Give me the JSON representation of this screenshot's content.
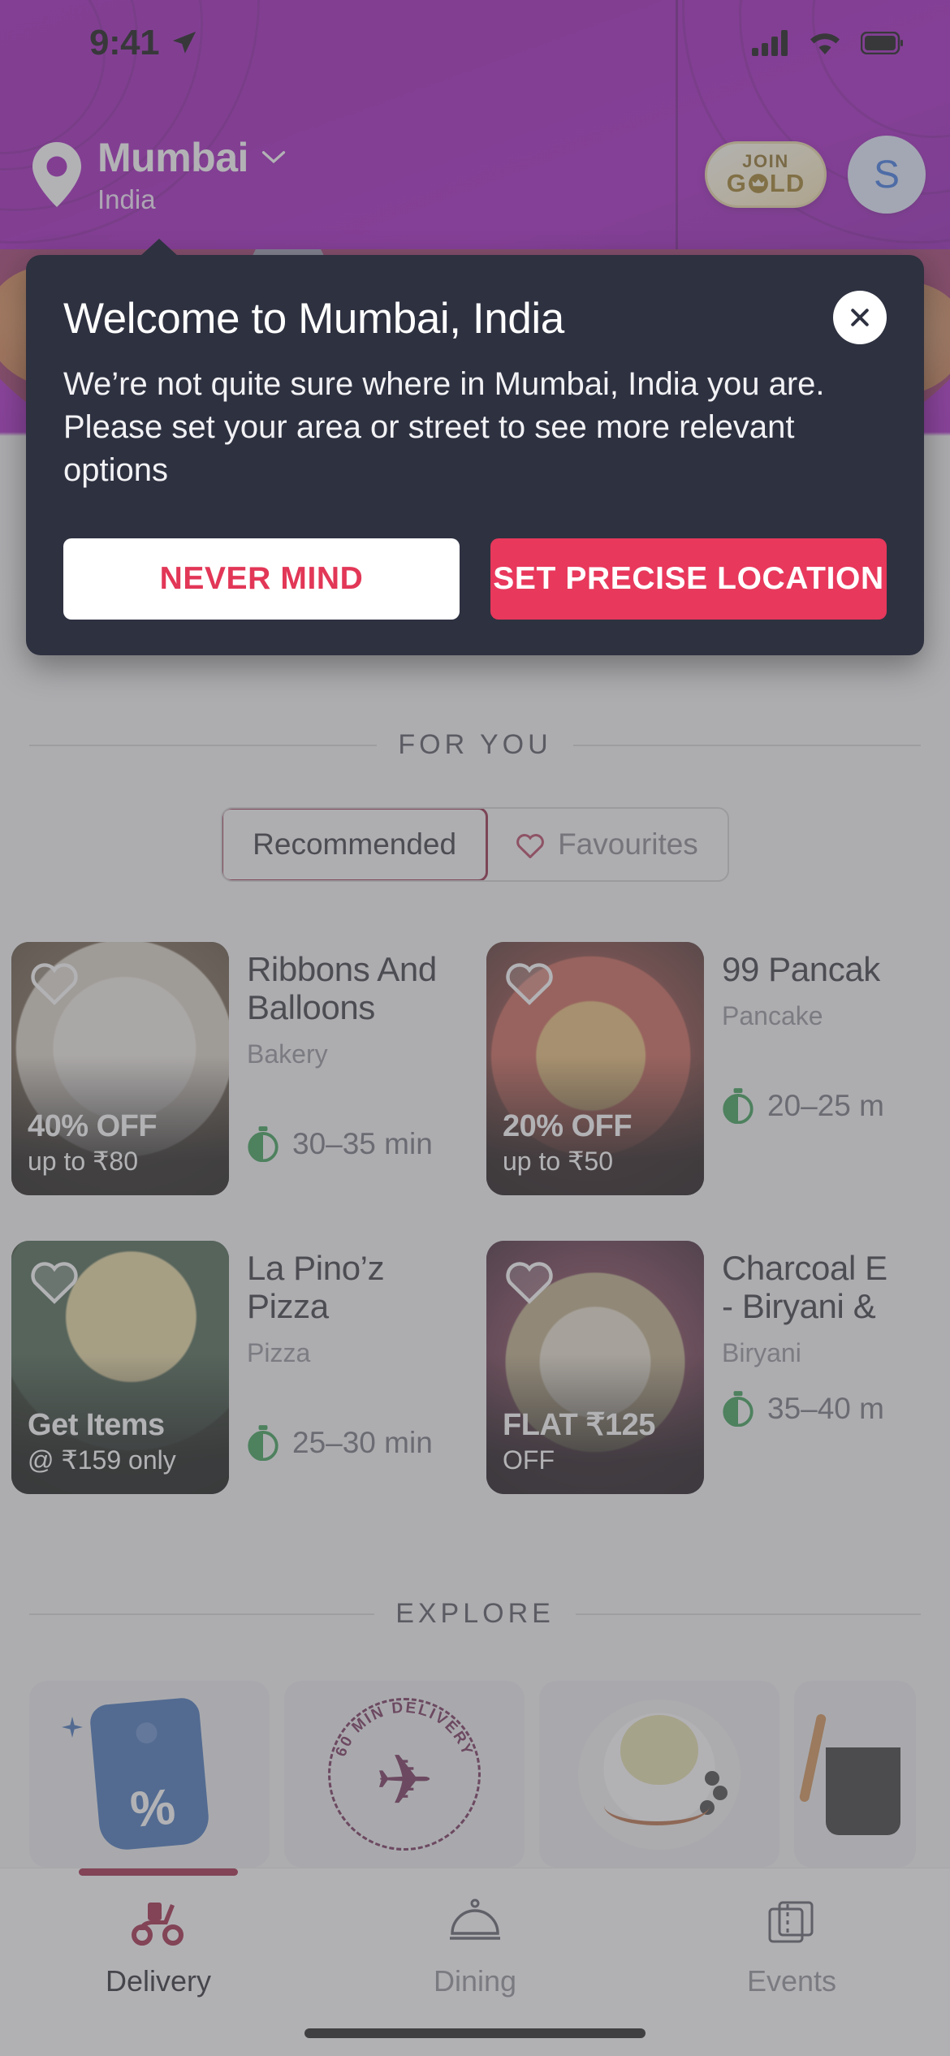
{
  "status_bar": {
    "time": "9:41",
    "icons": [
      "location-arrow-icon",
      "cellular-signal-icon",
      "wifi-icon",
      "battery-icon"
    ]
  },
  "header": {
    "location_icon": "location-pin-icon",
    "city": "Mumbai",
    "country": "India",
    "chevron": "chevron-down-icon",
    "gold_badge": {
      "line1": "JOIN",
      "line2_left": "G",
      "line2_right": "LD",
      "crown": "crown-icon"
    },
    "avatar_initial": "S",
    "colors": {
      "purple": "#9b0fb6",
      "gold_text": "#9a7518",
      "avatar_bg": "#dfe8fb",
      "avatar_fg": "#2f6ee0"
    }
  },
  "modal": {
    "title": "Welcome to Mumbai, India",
    "body": "We’re not quite sure where in Mumbai, India you are. Please set your area or street to see more relevant options",
    "close_icon": "close-icon",
    "secondary_button": "NEVER MIND",
    "primary_button": "SET PRECISE LOCATION",
    "colors": {
      "bg": "#2e3140",
      "primary": "#e8385c",
      "secondary_text": "#e23757"
    }
  },
  "for_you": {
    "section_title": "FOR YOU",
    "tabs": [
      {
        "label": "Recommended",
        "active": true,
        "icon": null
      },
      {
        "label": "Favourites",
        "active": false,
        "icon": "heart-icon"
      }
    ],
    "cards": [
      {
        "name": "Ribbons And Balloons",
        "cuisine": "Bakery",
        "offer_main": "40% OFF",
        "offer_sub": "up to ₹80",
        "eta": "30–35 min",
        "favourite_icon": "heart-outline-icon",
        "timer_icon": "timer-icon"
      },
      {
        "name": "99 Pancak",
        "cuisine": "Pancake",
        "offer_main": "20% OFF",
        "offer_sub": "up to ₹50",
        "eta": "20–25 m",
        "favourite_icon": "heart-outline-icon",
        "timer_icon": "timer-icon"
      },
      {
        "name": "La Pino’z Pizza",
        "cuisine": "Pizza",
        "offer_main": "Get Items",
        "offer_sub": "@ ₹159 only",
        "eta": "25–30 min",
        "favourite_icon": "heart-outline-icon",
        "timer_icon": "timer-icon"
      },
      {
        "name": "Charcoal E - Biryani &",
        "name_line1": "Charcoal E",
        "name_line2": "- Biryani &",
        "cuisine": "Biryani",
        "offer_main": "FLAT ₹125",
        "offer_sub": "OFF",
        "eta": "35–40 m",
        "favourite_icon": "heart-outline-icon",
        "timer_icon": "timer-icon"
      }
    ]
  },
  "explore": {
    "section_title": "EXPLORE",
    "tiles": [
      {
        "icon": "discount-tag-icon",
        "pct": "%"
      },
      {
        "icon": "sixty-min-delivery-icon",
        "ring_text": "60 MIN DELIVERY",
        "glyph": "✈"
      },
      {
        "icon": "food-plate-icon"
      },
      {
        "icon": "chai-cup-icon"
      }
    ]
  },
  "bottom_nav": {
    "items": [
      {
        "label": "Delivery",
        "icon": "scooter-icon",
        "active": true
      },
      {
        "label": "Dining",
        "icon": "cloche-icon",
        "active": false
      },
      {
        "label": "Events",
        "icon": "tickets-icon",
        "active": false
      }
    ],
    "active_color": "#9b1b3a"
  }
}
